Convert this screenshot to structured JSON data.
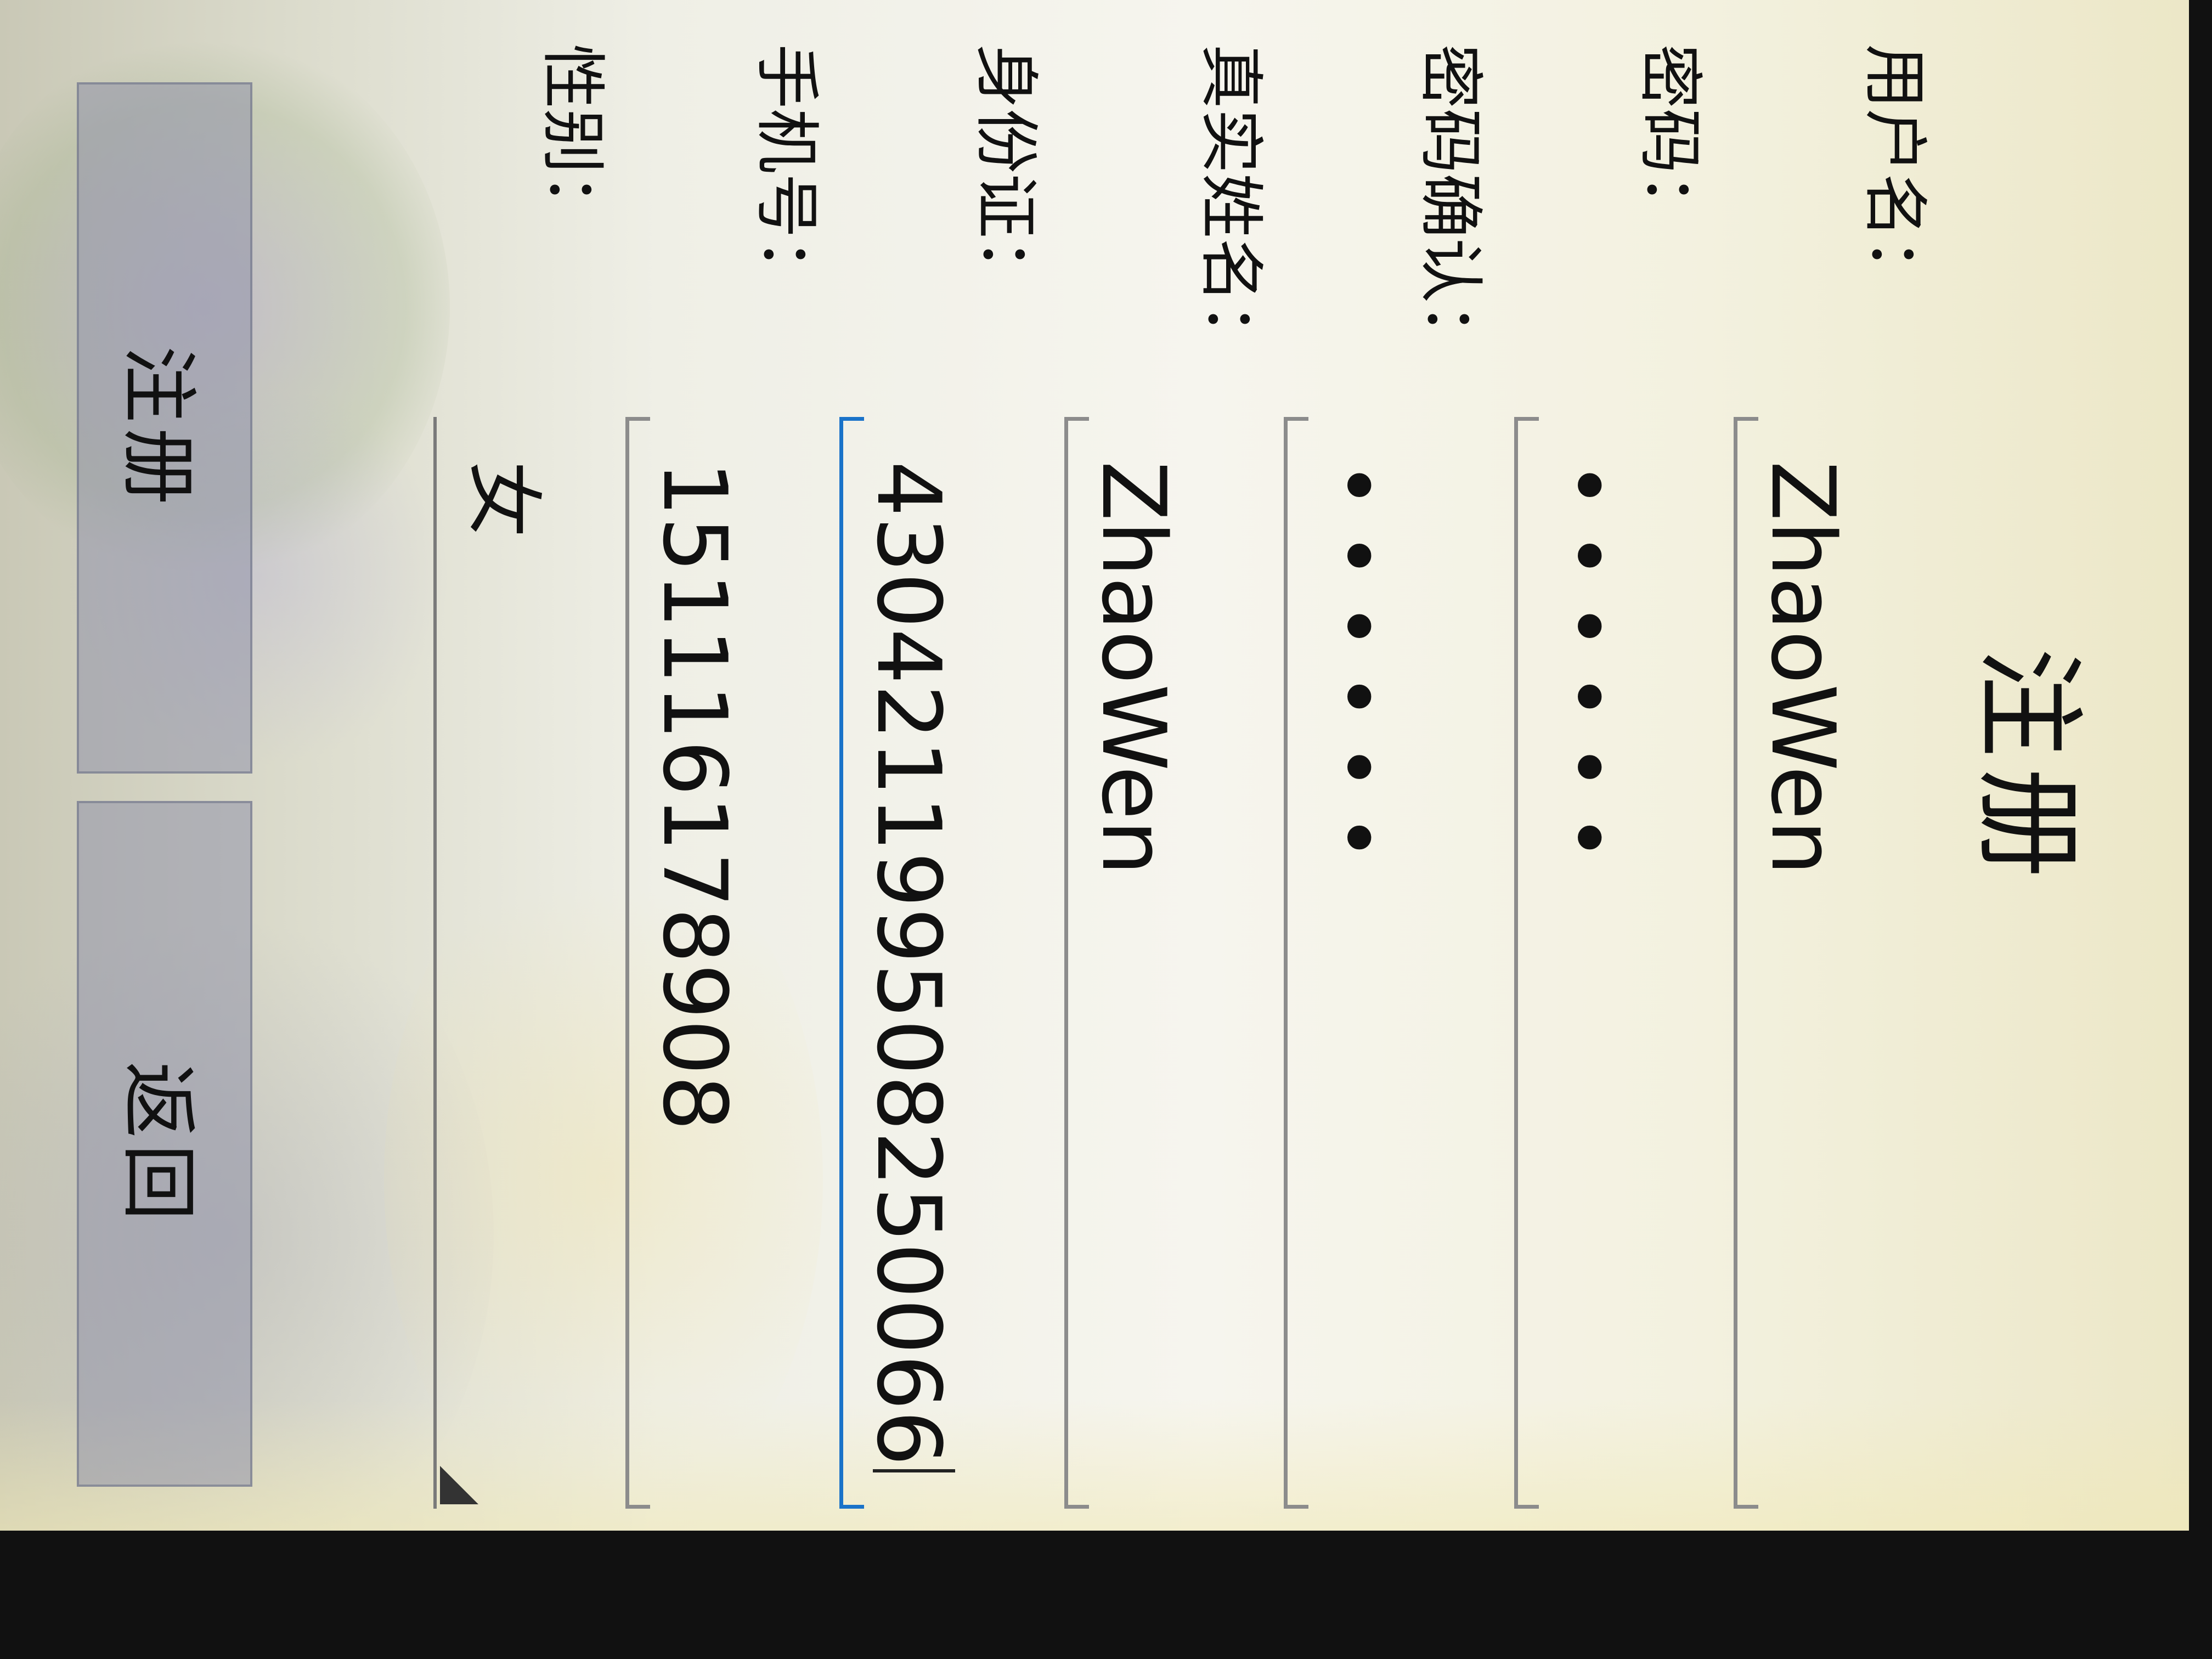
{
  "page_title": "注册",
  "form": {
    "username": {
      "label": "用户名：",
      "value": "ZhaoWen"
    },
    "password": {
      "label": "密码：",
      "value": "••••••"
    },
    "confirm_password": {
      "label": "密码确认：",
      "value": "••••••"
    },
    "real_name": {
      "label": "真实姓名：",
      "value": "ZhaoWen"
    },
    "id_card": {
      "label": "身份证：",
      "value": "430421199508250066"
    },
    "phone": {
      "label": "手机号：",
      "value": "15111617890​8"
    },
    "gender": {
      "label": "性别：",
      "value": "女"
    }
  },
  "buttons": {
    "register": "注册",
    "back": "返回"
  },
  "colors": {
    "focus_underline": "#1a73c9",
    "field_underline": "#8c8c8c"
  }
}
